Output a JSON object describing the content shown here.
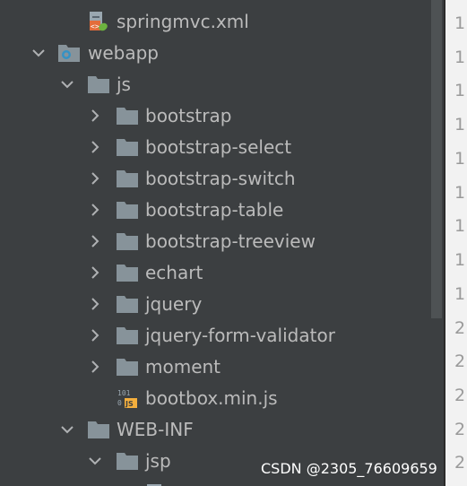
{
  "tree": {
    "items": [
      {
        "label": "springmvc.xml",
        "kind": "xml-file",
        "expanded": null
      },
      {
        "label": "webapp",
        "kind": "web-folder",
        "expanded": true
      },
      {
        "label": "js",
        "kind": "folder",
        "expanded": true
      },
      {
        "label": "bootstrap",
        "kind": "folder",
        "expanded": false
      },
      {
        "label": "bootstrap-select",
        "kind": "folder",
        "expanded": false
      },
      {
        "label": "bootstrap-switch",
        "kind": "folder",
        "expanded": false
      },
      {
        "label": "bootstrap-table",
        "kind": "folder",
        "expanded": false
      },
      {
        "label": "bootstrap-treeview",
        "kind": "folder",
        "expanded": false
      },
      {
        "label": "echart",
        "kind": "folder",
        "expanded": false
      },
      {
        "label": "jquery",
        "kind": "folder",
        "expanded": false
      },
      {
        "label": "jquery-form-validator",
        "kind": "folder",
        "expanded": false
      },
      {
        "label": "moment",
        "kind": "folder",
        "expanded": false
      },
      {
        "label": "bootbox.min.js",
        "kind": "js-file",
        "expanded": null
      },
      {
        "label": "WEB-INF",
        "kind": "folder",
        "expanded": true
      },
      {
        "label": "jsp",
        "kind": "folder",
        "expanded": true
      }
    ]
  },
  "gutter": {
    "line_numbers": [
      "1",
      "1",
      "1",
      "1",
      "1",
      "1",
      "1",
      "1",
      "1",
      "2",
      "2",
      "2",
      "2",
      "2",
      "2"
    ]
  },
  "watermark": {
    "text": "CSDN @2305_76609659"
  },
  "colors": {
    "tree_background": "#3c3f41",
    "text": "#bbbbbb",
    "folder_icon": "#87939a",
    "gutter_background": "#f2f2f2",
    "scroll_thumb": "#4e5254"
  }
}
